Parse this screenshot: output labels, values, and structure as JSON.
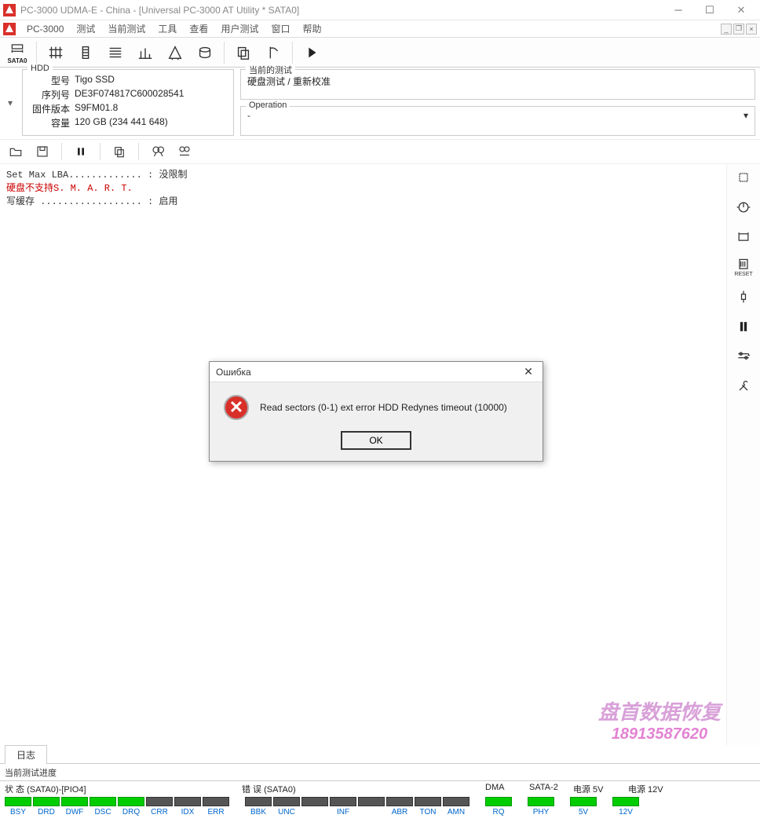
{
  "window": {
    "title": "PC-3000 UDMA-E - China - [Universal PC-3000 AT Utility * SATA0]"
  },
  "menu": {
    "app": "PC-3000",
    "items": [
      "测试",
      "当前测试",
      "工具",
      "查看",
      "用户测试",
      "窗口",
      "帮助"
    ]
  },
  "toolbar": {
    "sata_label": "SATA0"
  },
  "hdd": {
    "legend": "HDD",
    "model_label": "型号",
    "model": "Tigo SSD",
    "serial_label": "序列号",
    "serial": "DE3F074817C600028541",
    "fw_label": "固件版本",
    "fw": "S9FM01.8",
    "capacity_label": "容量",
    "capacity": "120 GB (234 441 648)"
  },
  "current_test": {
    "legend": "当前的测试",
    "line": "硬盘测试 / 重新校准"
  },
  "operation": {
    "legend": "Operation",
    "value": "-"
  },
  "log": {
    "line1_left": "Set Max LBA.............",
    "line1_sep": " : ",
    "line1_right": "没限制",
    "line2": "硬盘不支持S. M. A. R. T.",
    "line3_left": "写缓存 ..................",
    "line3_sep": " : ",
    "line3_right": "启用"
  },
  "right_sidebar": {
    "reset_label": "RESET"
  },
  "tabs": {
    "log": "日志"
  },
  "progress": {
    "label": "当前测试进度"
  },
  "status": {
    "state_label": "状 态 (SATA0)-[PIO4]",
    "error_label": "错 误 (SATA0)",
    "dma_label": "DMA",
    "sata2_label": "SATA-2",
    "power5v_label": "电源 5V",
    "power12v_label": "电源 12V",
    "state_leds": [
      {
        "name": "BSY",
        "on": true
      },
      {
        "name": "DRD",
        "on": true
      },
      {
        "name": "DWF",
        "on": true
      },
      {
        "name": "DSC",
        "on": true
      },
      {
        "name": "DRQ",
        "on": true
      },
      {
        "name": "CRR",
        "on": false
      },
      {
        "name": "IDX",
        "on": false
      },
      {
        "name": "ERR",
        "on": false
      }
    ],
    "error_leds": [
      {
        "name": "BBK",
        "on": false
      },
      {
        "name": "UNC",
        "on": false
      },
      {
        "name": "",
        "on": false
      },
      {
        "name": "INF",
        "on": false
      },
      {
        "name": "",
        "on": false
      },
      {
        "name": "ABR",
        "on": false
      },
      {
        "name": "TON",
        "on": false
      },
      {
        "name": "AMN",
        "on": false
      }
    ],
    "dma_leds": [
      {
        "name": "RQ",
        "on": true
      }
    ],
    "sata2_leds": [
      {
        "name": "PHY",
        "on": true
      }
    ],
    "p5v_leds": [
      {
        "name": "5V",
        "on": true
      }
    ],
    "p12v_leds": [
      {
        "name": "12V",
        "on": true
      }
    ]
  },
  "watermark": {
    "line1": "盘首数据恢复",
    "line2": "18913587620"
  },
  "dialog": {
    "title": "Ошибка",
    "message": "Read sectors (0-1) ext error HDD Redynes timeout (10000)",
    "ok": "OK"
  }
}
